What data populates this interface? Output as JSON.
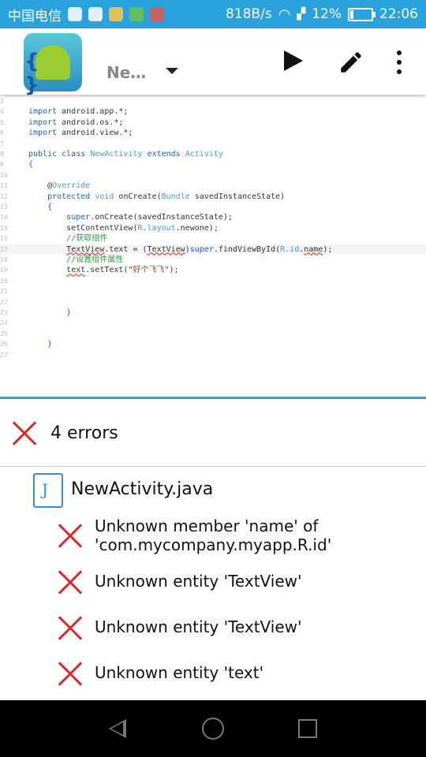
{
  "status_bar": {
    "carrier": "中国电信",
    "net_speed": "818B/s",
    "battery": "12%",
    "time": "22:06",
    "icons": [
      "weibo-icon",
      "shield-icon",
      "lock-app-icon",
      "bb-icon",
      "game-icon",
      "wifi-icon",
      "signal-icon",
      "battery-icon"
    ]
  },
  "app_bar": {
    "title": "Ne…",
    "icons": [
      "app-logo-icon",
      "dropdown-icon",
      "play-icon",
      "edit-icon",
      "more-icon"
    ]
  },
  "code": {
    "lines": [
      {
        "n": "3",
        "html": ""
      },
      {
        "n": "4",
        "html": "<span class='kw'>import</span> android.app.*;"
      },
      {
        "n": "5",
        "html": "<span class='kw'>import</span> android.os.*;"
      },
      {
        "n": "6",
        "html": "<span class='kw'>import</span> android.view.*;"
      },
      {
        "n": "7",
        "html": ""
      },
      {
        "n": "8",
        "html": "<span class='kw'>public class</span> <span class='ty'>NewActivity</span> <span class='kw'>extends</span> <span class='ty'>Activity</span>"
      },
      {
        "n": "9",
        "html": "<span class='kw'>{</span>"
      },
      {
        "n": "10",
        "html": ""
      },
      {
        "n": "11",
        "html": "    @<span class='ty'>Override</span>"
      },
      {
        "n": "12",
        "html": "    <span class='kw'>protected</span> <span class='ty'>void</span> onCreate(<span class='ty'>Bundle</span> savedInstanceState)"
      },
      {
        "n": "13",
        "html": "    <span class='kw'>{</span>"
      },
      {
        "n": "14",
        "html": "        <span class='kw'>super</span>.onCreate(savedInstanceState);"
      },
      {
        "n": "15",
        "html": "        setContentView(<span class='ty'>R.layout</span>.newone);"
      },
      {
        "n": "16",
        "html": "        <span class='cm'>//获取组件</span>"
      },
      {
        "n": "17",
        "html": "        <span class='err'>TextView</span>.text = (<span class='err'>TextView</span>)<span class='kw'>super</span>.findViewById(<span class='ty'>R.id</span>.<span class='err'>name</span>);",
        "hl": true
      },
      {
        "n": "18",
        "html": "        <span class='cm'>//设置组件属性</span>"
      },
      {
        "n": "19",
        "html": "        <span class='err'>text</span>.setText(<span class='st'>\"好个飞飞\"</span>);"
      },
      {
        "n": "20",
        "html": ""
      },
      {
        "n": "21",
        "html": ""
      },
      {
        "n": "22",
        "html": ""
      },
      {
        "n": "23",
        "html": "        <span class='kw'>}</span>"
      },
      {
        "n": "24",
        "html": ""
      },
      {
        "n": "25",
        "html": ""
      },
      {
        "n": "26",
        "html": "    <span class='kw'>}</span>"
      },
      {
        "n": "27",
        "html": ""
      }
    ]
  },
  "errors": {
    "summary": "4 errors",
    "file": "NewActivity.java",
    "items": [
      {
        "line1": "Unknown member 'name' of",
        "line2": "'com.mycompany.myapp.R.id'"
      },
      {
        "line1": "Unknown entity 'TextView'",
        "line2": ""
      },
      {
        "line1": "Unknown entity 'TextView'",
        "line2": ""
      },
      {
        "line1": "Unknown entity 'text'",
        "line2": ""
      }
    ]
  },
  "nav_bar": {
    "icons": [
      "back-icon",
      "home-icon",
      "recents-icon"
    ]
  },
  "colors": {
    "accent": "#2aa3dd",
    "error": "#d92b2b"
  }
}
